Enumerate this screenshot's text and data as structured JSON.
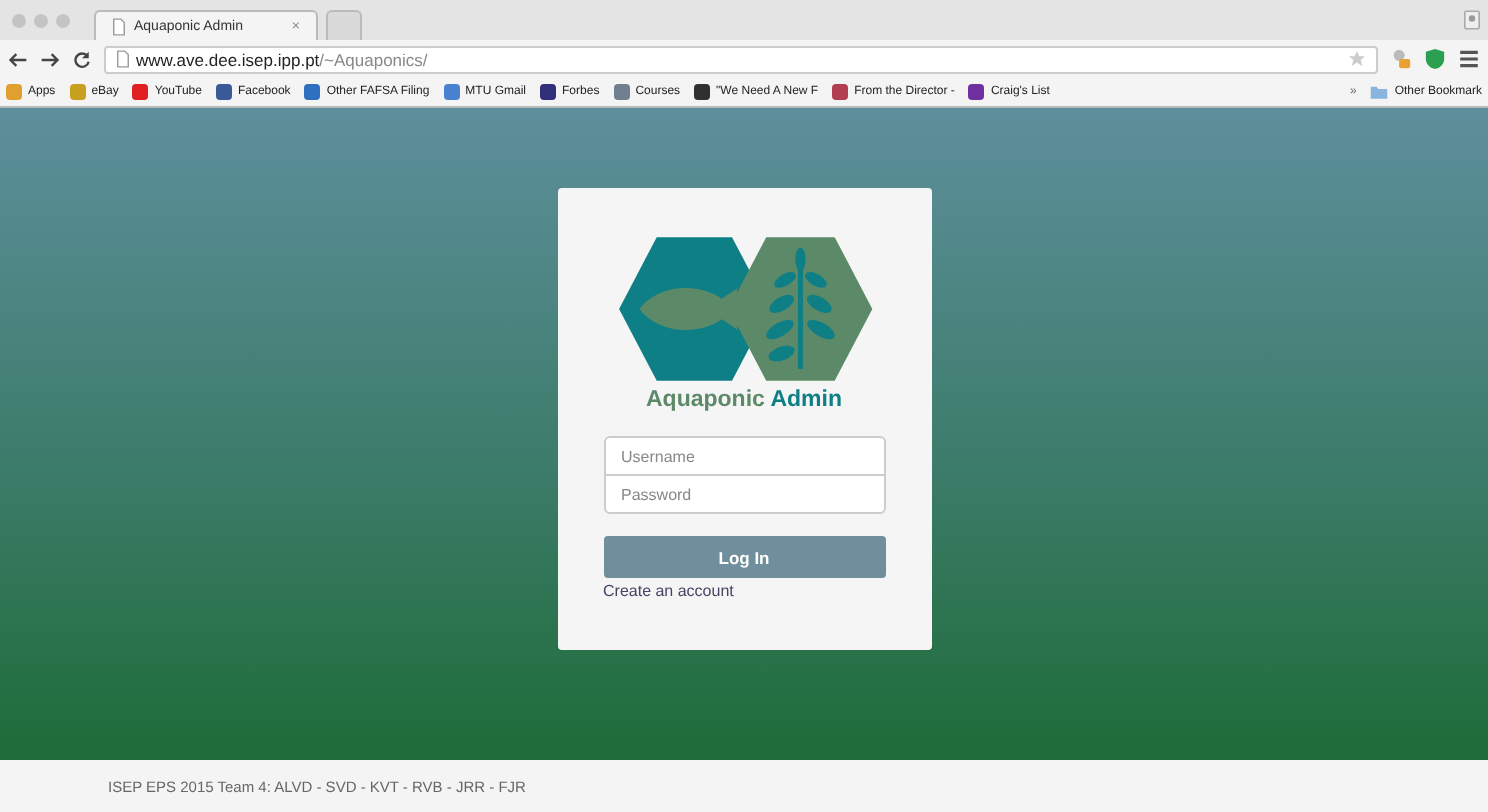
{
  "tabs": [
    {
      "title": "Aquaponic Admin",
      "close": "×",
      "selected": true
    },
    {
      "selected": false
    }
  ],
  "address_bar": {
    "host": "www.ave.dee.isep.ipp.pt",
    "path": "/~Aquaponics/"
  },
  "bookmarks": [
    {
      "label": "Apps",
      "color": "#e0a030"
    },
    {
      "label": "eBay",
      "color": "#c8a020"
    },
    {
      "label": "YouTube",
      "color": "#e02020"
    },
    {
      "label": "Facebook",
      "color": "#3b5998"
    },
    {
      "label": "Other FAFSA Filing",
      "color": "#3070c0"
    },
    {
      "label": "MTU Gmail",
      "color": "#4a80d0"
    },
    {
      "label": "Forbes",
      "color": "#30307a"
    },
    {
      "label": "Courses",
      "color": "#708090"
    },
    {
      "label": "\"We Need A New F",
      "color": "#303030"
    },
    {
      "label": "From the Director -",
      "color": "#b04050"
    },
    {
      "label": "Craig's List",
      "color": "#7030a0"
    }
  ],
  "overflow": "»",
  "other_bookmarks": "Other Bookmark",
  "login": {
    "brand_first": "Aquaponic",
    "brand_second": "Admin",
    "username_placeholder": "Username",
    "password_placeholder": "Password",
    "button": "Log In",
    "link": "Create an account"
  },
  "footer": "ISEP EPS 2015 Team 4: ALVD - SVD - KVT - RVB - JRR - FJR"
}
